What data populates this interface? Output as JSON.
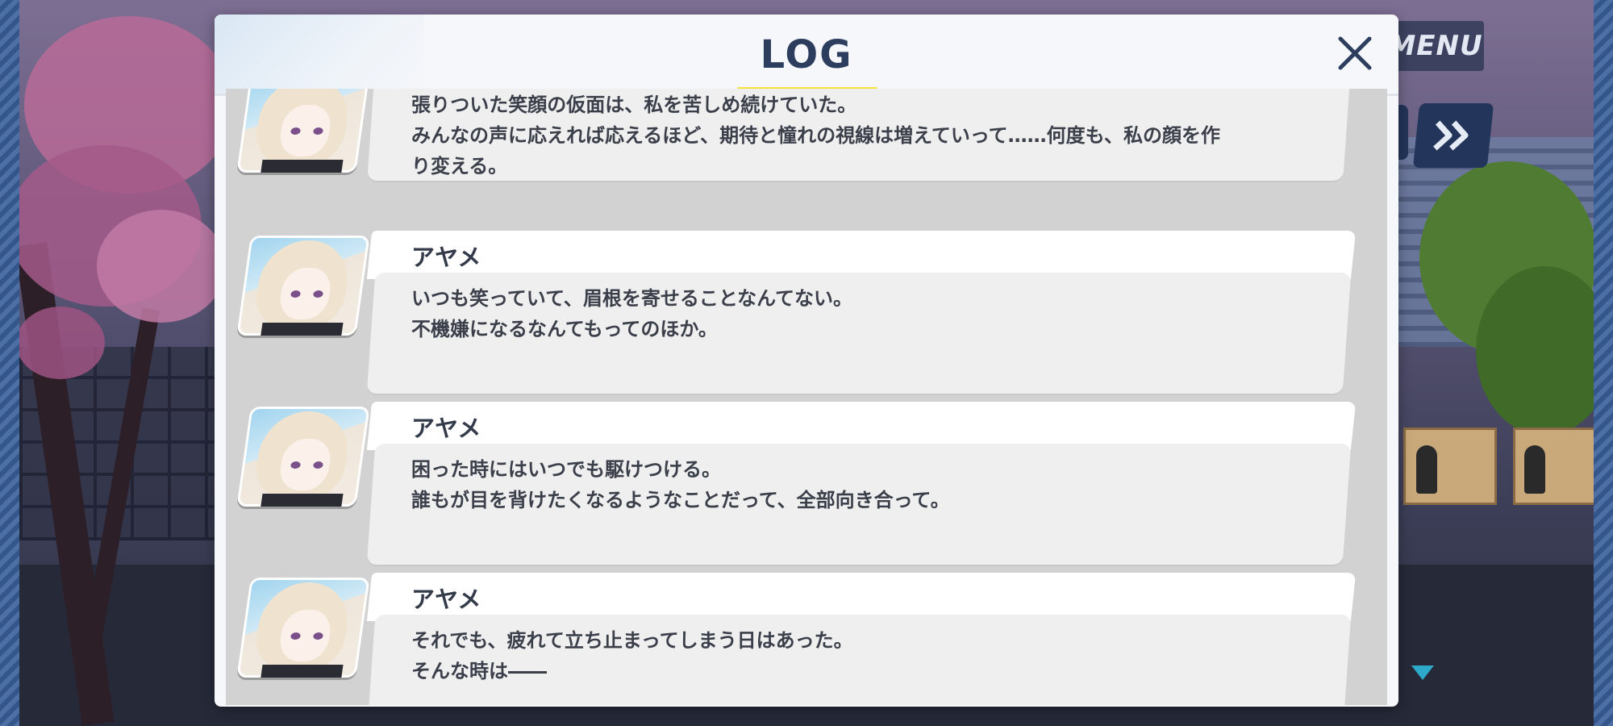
{
  "header": {
    "title": "LOG",
    "close_icon": "close-icon"
  },
  "hud": {
    "menu_label": "MENU",
    "skip_icon": "fast-forward-icon",
    "scroll_icon": "scroll-down-icon"
  },
  "colors": {
    "title_underline": "#f4e23a",
    "title_text": "#2c3d5e",
    "hud_button": "#23355a"
  },
  "log_entries": [
    {
      "speaker": "",
      "lines": [
        "張りついた笑顔の仮面は、私を苦しめ続けていた。",
        "みんなの声に応えれば応えるほど、期待と憧れの視線は増えていって……何度も、私の顔を作",
        "り変える。"
      ]
    },
    {
      "speaker": "アヤメ",
      "lines": [
        "いつも笑っていて、眉根を寄せることなんてない。",
        "不機嫌になるなんてもってのほか。"
      ]
    },
    {
      "speaker": "アヤメ",
      "lines": [
        "困った時にはいつでも駆けつける。",
        "誰もが目を背けたくなるようなことだって、全部向き合って。"
      ]
    },
    {
      "speaker": "アヤメ",
      "lines": [
        "それでも、疲れて立ち止まってしまう日はあった。",
        "そんな時は――"
      ]
    }
  ]
}
